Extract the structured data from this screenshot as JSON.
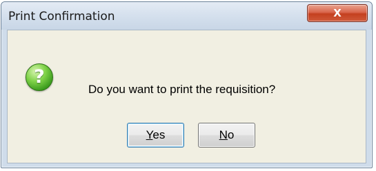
{
  "window": {
    "title": "Print Confirmation",
    "close_label": "X"
  },
  "dialog": {
    "icon": "question-icon",
    "icon_glyph": "?",
    "message": "Do you want to print the requisition?"
  },
  "buttons": {
    "yes": {
      "mnemonic": "Y",
      "rest": "es"
    },
    "no": {
      "mnemonic": "N",
      "rest": "o"
    }
  },
  "colors": {
    "client_background": "#f1efe2",
    "frame": "#cfdcea",
    "close_button": "#c4401f",
    "icon_green": "#3c9c1e",
    "default_button_border": "#3c7fb1"
  }
}
